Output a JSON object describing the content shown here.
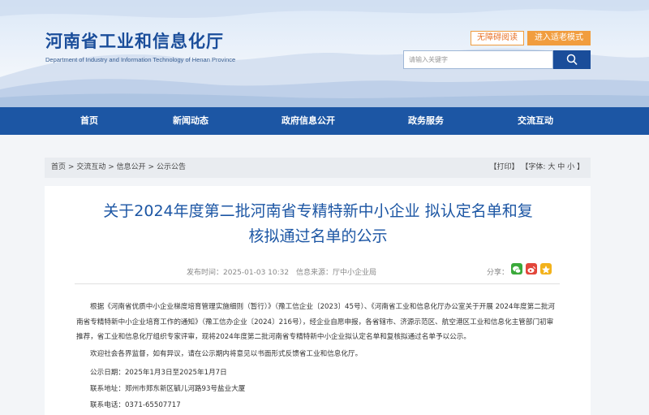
{
  "header": {
    "logo_cn": "河南省工业和信息化厅",
    "logo_en": "Department of Industry and Information Technology of Henan Province",
    "accessibility_label": "无障碍阅读",
    "elder_mode_label": "进入适老模式",
    "search_placeholder": "请输入关键字",
    "search_icon": "search-icon"
  },
  "nav": {
    "items": [
      "首页",
      "新闻动态",
      "政府信息公开",
      "政务服务",
      "交流互动"
    ]
  },
  "breadcrumb": {
    "items": [
      "首页",
      "交流互动",
      "信息公开",
      "公示公告"
    ],
    "separator": ">",
    "print_label": "【打印】",
    "font_label": "【字体:",
    "font_large": "大",
    "font_medium": "中",
    "font_small": "小",
    "font_close": "】"
  },
  "article": {
    "title_line1": "关于2024年度第二批河南省专精特新中小企业 拟认定名单和复",
    "title_line2": "核拟通过名单的公示",
    "publish_time": "发布时间：2025-01-03 10:32",
    "source": "信息来源：厅中小企业局",
    "share_label": "分享：",
    "share_icons": [
      "wechat-icon",
      "weibo-icon",
      "qzone-icon"
    ],
    "paragraph1": "根据《河南省优质中小企业梯度培育管理实施细则（暂行）》（豫工信企业〔2023〕45号）、《河南省工业和信息化厅办公室关于开展 2024年度第二批河南省专精特新中小企业培育工作的通知》（豫工信办企业〔2024〕216号），经企业自愿申报，各省辖市、济源示范区、航空港区工业和信息化主管部门初审推荐，省工业和信息化厅组织专家评审，现将2024年度第二批河南省专精特新中小企业拟认定名单和复核拟通过名单予以公示。",
    "paragraph2": "欢迎社会各界监督，如有异议，请在公示期内将意见以书面形式反馈省工业和信息化厅。",
    "period": "公示日期：2025年1月3日至2025年1月7日",
    "address": "联系地址：郑州市郑东新区毓儿河路93号盐业大厦",
    "phone": "联系电话：0371-65507717"
  },
  "colors": {
    "brand_blue": "#1c56a4",
    "accent_orange": "#f19d3e",
    "wechat_green": "#3aa93a",
    "weibo_red": "#e2463a",
    "qzone_yellow": "#f3b21b"
  }
}
